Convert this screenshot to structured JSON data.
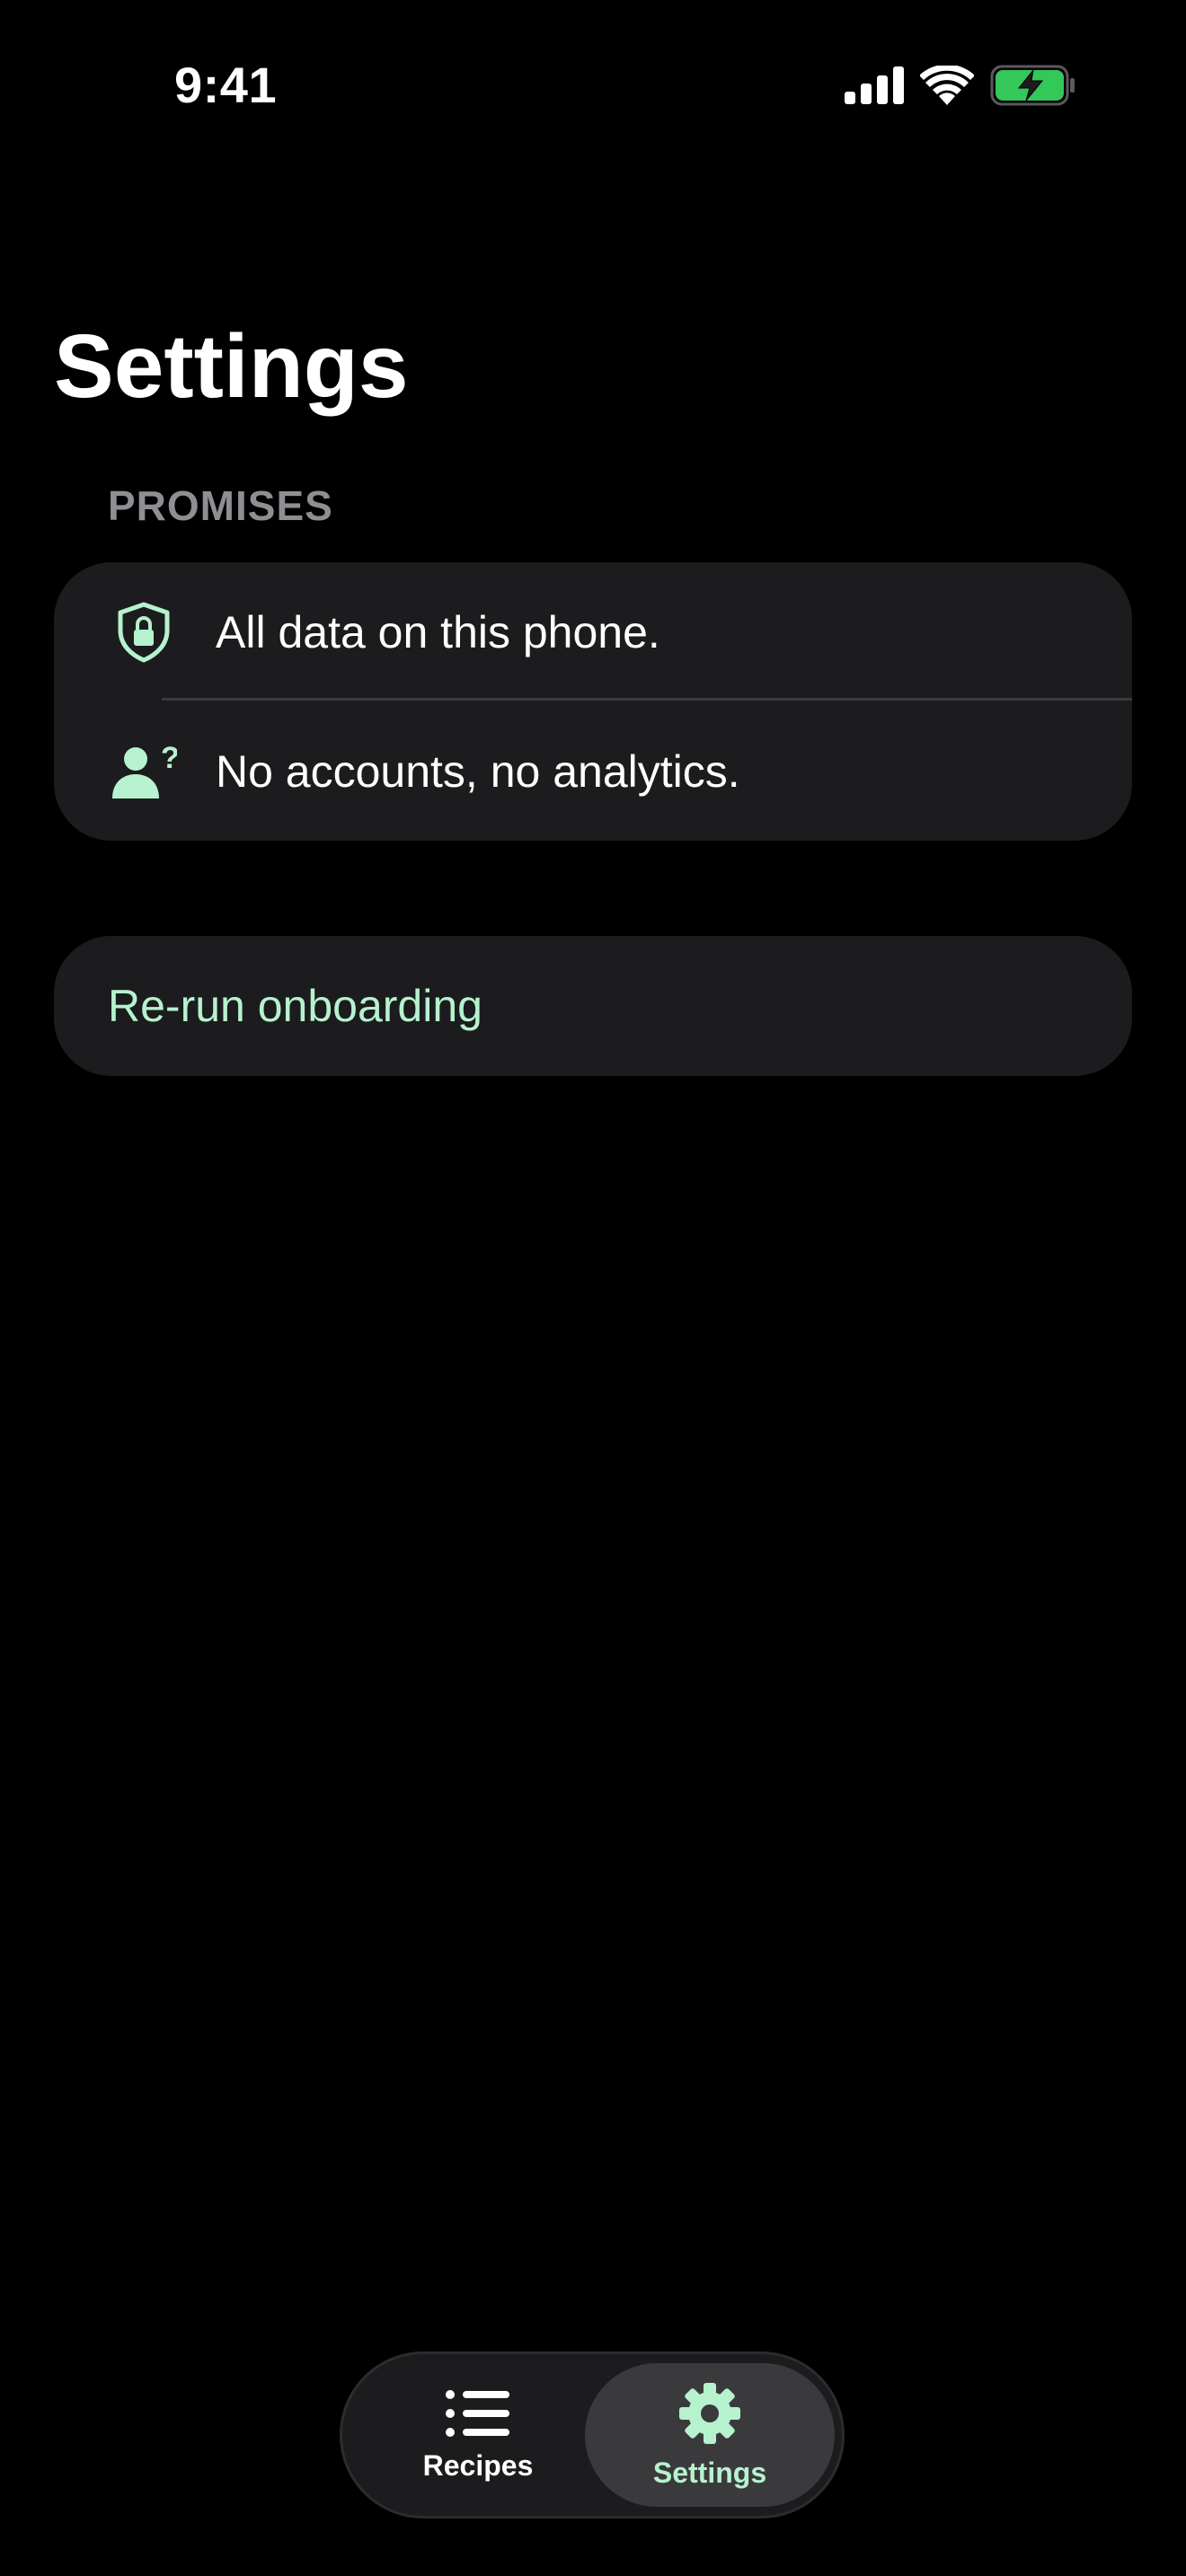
{
  "status_bar": {
    "time": "9:41"
  },
  "page": {
    "title": "Settings"
  },
  "promises": {
    "section_title": "PROMISES",
    "items": [
      {
        "icon": "lock-shield-icon",
        "label": "All data on this phone."
      },
      {
        "icon": "person-question-icon",
        "label": "No accounts, no analytics."
      }
    ]
  },
  "actions": {
    "rerun_onboarding": "Re-run onboarding"
  },
  "tab_bar": {
    "tabs": [
      {
        "icon": "list-icon",
        "label": "Recipes",
        "selected": false
      },
      {
        "icon": "gear-icon",
        "label": "Settings",
        "selected": true
      }
    ]
  },
  "colors": {
    "background": "#000000",
    "card": "#1c1c1e",
    "accent": "#b7f2cf",
    "secondary_text": "#8e8e93",
    "battery_fill": "#34c759"
  }
}
